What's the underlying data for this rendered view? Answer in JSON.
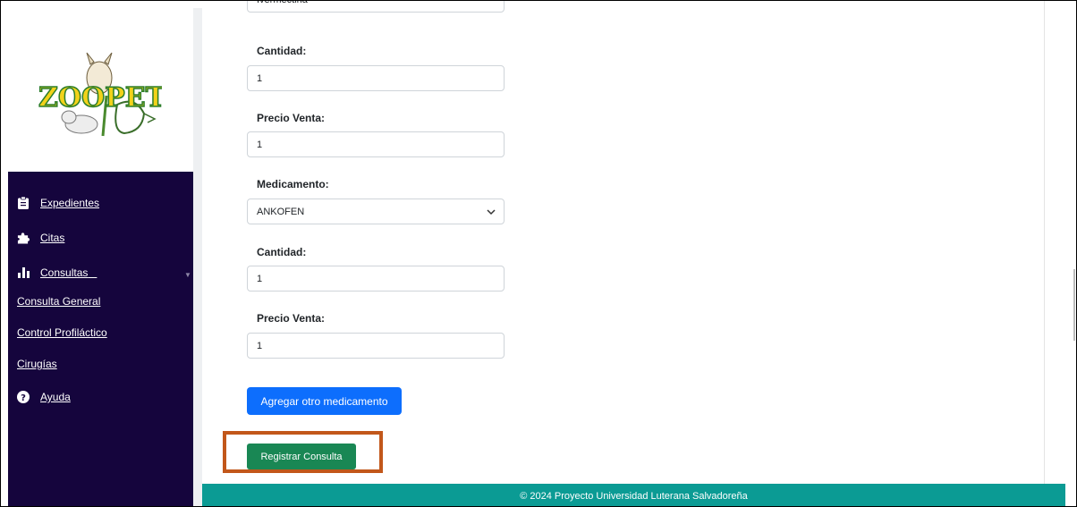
{
  "sidebar": {
    "logo_text": "ZOOPET",
    "items": [
      {
        "label": "Expedientes",
        "icon": "clipboard-icon"
      },
      {
        "label": "Citas",
        "icon": "puzzle-icon"
      },
      {
        "label": "Consultas",
        "icon": "bar-chart-icon"
      },
      {
        "label": "Consulta General"
      },
      {
        "label": "Control Profiláctico"
      },
      {
        "label": "Cirugías"
      },
      {
        "label": "Ayuda",
        "icon": "help-circle-icon"
      }
    ]
  },
  "form": {
    "top_partial_value": "Ivermectina",
    "cantidad_label": "Cantidad:",
    "cantidad_1_value": "1",
    "precio_label": "Precio Venta:",
    "precio_1_value": "1",
    "medicamento_label": "Medicamento:",
    "medicamento_value": "ANKOFEN",
    "cantidad_2_value": "1",
    "precio_2_value": "1",
    "add_med_button": "Agregar otro medicamento",
    "register_button": "Registrar Consulta"
  },
  "footer": {
    "text": "© 2024 Proyecto Universidad Luterana Salvadoreña"
  },
  "colors": {
    "sidebar_bg": "#15053d",
    "primary": "#0d6efd",
    "success": "#198754",
    "footer_bg": "#0b9b94",
    "highlight": "#c2571a"
  }
}
